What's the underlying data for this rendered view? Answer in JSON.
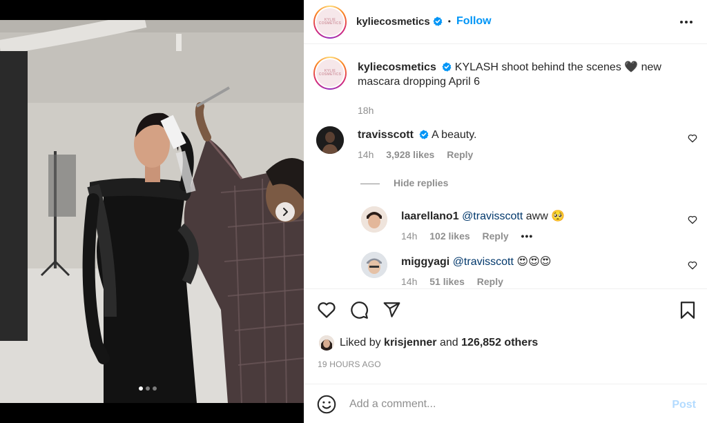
{
  "post": {
    "account": "kyliecosmetics",
    "avatar_logo_text": "KYLIE COSMETICS",
    "follow_label": "Follow",
    "separator": "•",
    "caption": "KYLASH shoot behind the scenes 🖤 new mascara dropping April 6",
    "caption_age": "18h",
    "carousel": {
      "slide_count": 3,
      "active_index": 0
    }
  },
  "comments": [
    {
      "user": "travisscott",
      "verified": true,
      "text": "A beauty.",
      "age": "14h",
      "likes": "3,928 likes",
      "reply_label": "Reply",
      "hide_replies_label": "Hide replies",
      "replies": [
        {
          "user": "laarellano1",
          "mention": "@travisscott",
          "text": "aww 🥺",
          "age": "14h",
          "likes": "102 likes",
          "reply_label": "Reply",
          "more": "•••"
        },
        {
          "user": "miggyagi",
          "mention": "@travisscott",
          "text": "😍😍😍",
          "age": "14h",
          "likes": "51 likes",
          "reply_label": "Reply"
        }
      ]
    }
  ],
  "likes": {
    "prefix": "Liked by",
    "user": "krisjenner",
    "middle": "and",
    "others": "126,852 others"
  },
  "timestamp": "19 HOURS AGO",
  "composer": {
    "placeholder": "Add a comment...",
    "post_label": "Post"
  },
  "colors": {
    "accent": "#0095f6",
    "verified": "#0095f6",
    "muted": "#8e8e8e",
    "post_disabled": "#b3dbff"
  }
}
